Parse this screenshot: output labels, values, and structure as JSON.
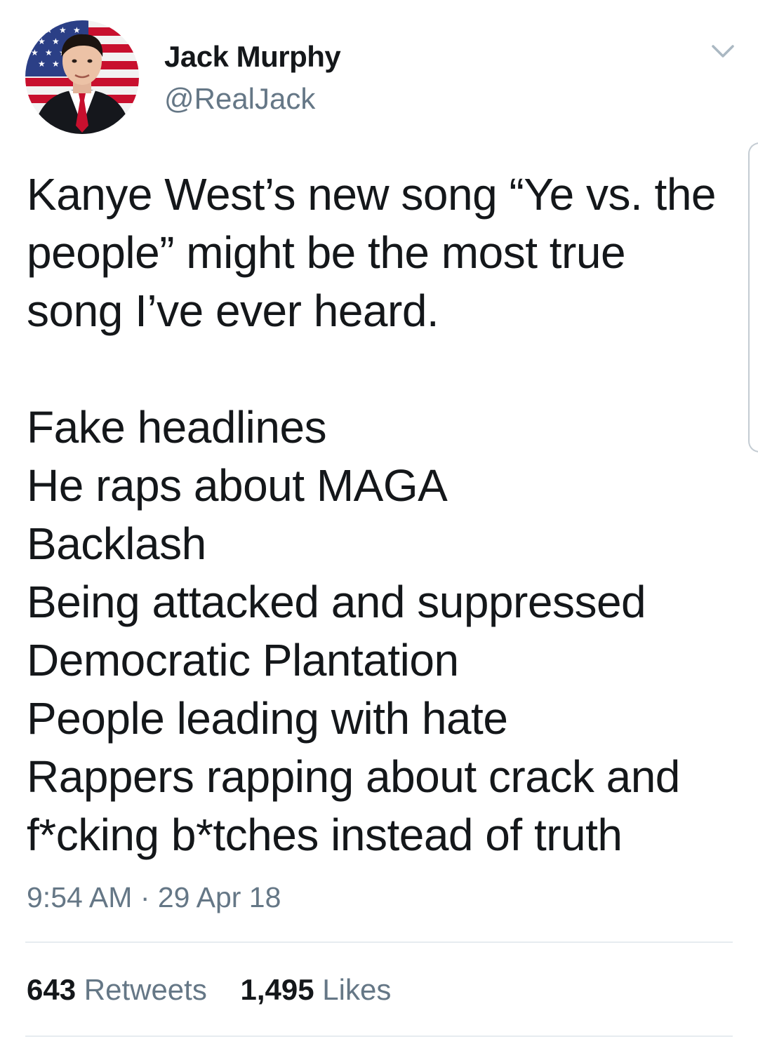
{
  "author": {
    "display_name": "Jack Murphy",
    "handle": "@RealJack"
  },
  "icons": {
    "menu": "chevron-down-icon",
    "avatar": "profile-photo"
  },
  "tweet": {
    "lines": [
      "Kanye West’s new song “Ye vs. the",
      "people” might be the most true",
      "song I’ve ever heard.",
      "",
      "Fake headlines",
      "He raps about MAGA",
      "Backlash",
      "Being attacked and suppressed",
      "Democratic Plantation",
      "People leading with hate",
      "Rappers rapping about crack and",
      "f*cking b*tches instead of truth"
    ],
    "timestamp": "9:54 AM · 29 Apr 18"
  },
  "stats": {
    "retweets_count": "643",
    "retweets_label": "Retweets",
    "likes_count": "1,495",
    "likes_label": "Likes"
  },
  "colors": {
    "text": "#14171a",
    "secondary": "#657786",
    "divider": "#e6ecf0"
  }
}
